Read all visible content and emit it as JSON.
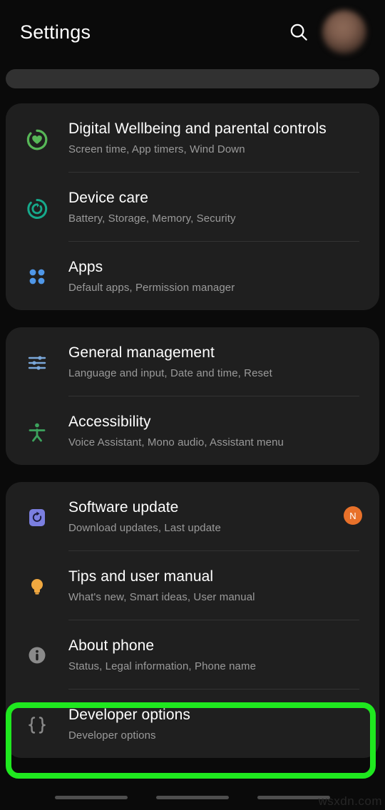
{
  "header": {
    "title": "Settings",
    "search_icon": "search-icon",
    "avatar": "user-avatar"
  },
  "cards": [
    {
      "id": "card-services",
      "rows": [
        {
          "id": "digital-wellbeing",
          "title": "Digital Wellbeing and parental controls",
          "subtitle": "Screen time, App timers, Wind Down",
          "icon": "digital-wellbeing-icon",
          "icon_color": "#57b757",
          "badge": null
        },
        {
          "id": "device-care",
          "title": "Device care",
          "subtitle": "Battery, Storage, Memory, Security",
          "icon": "device-care-icon",
          "icon_color": "#16a98b",
          "badge": null
        },
        {
          "id": "apps",
          "title": "Apps",
          "subtitle": "Default apps, Permission manager",
          "icon": "apps-grid-icon",
          "icon_color": "#4f97e8",
          "badge": null
        }
      ]
    },
    {
      "id": "card-system",
      "rows": [
        {
          "id": "general-management",
          "title": "General management",
          "subtitle": "Language and input, Date and time, Reset",
          "icon": "sliders-icon",
          "icon_color": "#7aa7d9",
          "badge": null
        },
        {
          "id": "accessibility",
          "title": "Accessibility",
          "subtitle": "Voice Assistant, Mono audio, Assistant menu",
          "icon": "accessibility-person-icon",
          "icon_color": "#3da35d",
          "badge": null
        }
      ]
    },
    {
      "id": "card-info",
      "rows": [
        {
          "id": "software-update",
          "title": "Software update",
          "subtitle": "Download updates, Last update",
          "icon": "software-update-icon",
          "icon_color": "#7b7fe0",
          "badge": "N"
        },
        {
          "id": "tips-and-user-manual",
          "title": "Tips and user manual",
          "subtitle": "What's new, Smart ideas, User manual",
          "icon": "lightbulb-icon",
          "icon_color": "#f0a840",
          "badge": null
        },
        {
          "id": "about-phone",
          "title": "About phone",
          "subtitle": "Status, Legal information, Phone name",
          "icon": "info-circle-icon",
          "icon_color": "#8a8a8a",
          "badge": null
        },
        {
          "id": "developer-options",
          "title": "Developer options",
          "subtitle": "Developer options",
          "icon": "curly-braces-icon",
          "icon_color": "#8a8a8a",
          "badge": null
        }
      ]
    }
  ],
  "highlight": {
    "target": "developer-options",
    "color": "#1fe81f"
  },
  "navbar": {
    "items": [
      "recents-button",
      "home-button",
      "back-button"
    ],
    "watermark": "wsxdn.com"
  },
  "colors": {
    "background": "#0a0a0a",
    "card": "#1f1f1f",
    "divider": "#333333",
    "title_text": "#ffffff",
    "subtitle_text": "#9a9a9a",
    "badge": "#e8712a",
    "highlight": "#1fe81f"
  }
}
